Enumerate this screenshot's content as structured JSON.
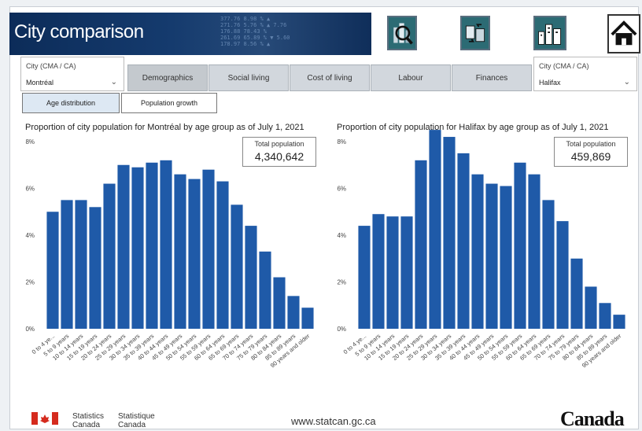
{
  "app": {
    "title": "City comparison",
    "banner_ticker": "377.76 8.98 % ▲\n271.76 5.76 % ▲ 7.76\n176.88 78.43 %\n261.69 65.89 % ▼ 5.60\n178.97 8.56 % ▲"
  },
  "nav_icons": [
    "city-search-icon",
    "city-compare-icon",
    "city-skyline-icon",
    "home-icon"
  ],
  "left_city": {
    "label": "City (CMA / CA)",
    "value": "Montréal"
  },
  "right_city": {
    "label": "City (CMA / CA)",
    "value": "Halifax"
  },
  "tabs": [
    "Demographics",
    "Social living",
    "Cost of living",
    "Labour",
    "Finances"
  ],
  "active_tab": "Demographics",
  "subtabs": [
    "Age distribution",
    "Population growth"
  ],
  "active_subtab": "Age distribution",
  "chart_data": [
    {
      "type": "bar",
      "title": "Proportion of city population for Montréal by age group as of July 1, 2021",
      "total_label": "Total population",
      "total_value": "4,340,642",
      "ylim": [
        0,
        8
      ],
      "yticks": [
        "0%",
        "2%",
        "4%",
        "6%",
        "8%"
      ],
      "grid": false,
      "color": "#1f5aa8",
      "categories": [
        "0 to 4 ye...",
        "5 to 9 years",
        "10 to 14 years",
        "15 to 19 years",
        "20 to 24 years",
        "25 to 29 years",
        "30 to 34 years",
        "35 to 39 years",
        "40 to 44 years",
        "45 to 49 years",
        "50 to 54 years",
        "55 to 59 years",
        "60 to 64 years",
        "65 to 69 years",
        "70 to 74 years",
        "75 to 79 years",
        "80 to 84 years",
        "85 to 89 years",
        "90 years and older"
      ],
      "values": [
        5.0,
        5.5,
        5.5,
        5.2,
        6.2,
        7.0,
        6.9,
        7.1,
        7.2,
        6.6,
        6.4,
        6.8,
        6.3,
        5.3,
        4.4,
        3.3,
        2.2,
        1.4,
        0.9
      ]
    },
    {
      "type": "bar",
      "title": "Proportion of city population for Halifax by age group as of July 1, 2021",
      "total_label": "Total population",
      "total_value": "459,869",
      "ylim": [
        0,
        8
      ],
      "yticks": [
        "0%",
        "2%",
        "4%",
        "6%",
        "8%"
      ],
      "grid": false,
      "color": "#1f5aa8",
      "categories": [
        "0 to 4 ye...",
        "5 to 9 years",
        "10 to 14 years",
        "15 to 19 years",
        "20 to 24 years",
        "25 to 29 years",
        "30 to 34 years",
        "35 to 39 years",
        "40 to 44 years",
        "45 to 49 years",
        "50 to 54 years",
        "55 to 59 years",
        "60 to 64 years",
        "65 to 69 years",
        "70 to 74 years",
        "75 to 79 years",
        "80 to 84 years",
        "85 to 89 years",
        "90 years and older"
      ],
      "values": [
        4.4,
        4.9,
        4.8,
        4.8,
        7.2,
        8.5,
        8.2,
        7.5,
        6.6,
        6.2,
        6.1,
        7.1,
        6.6,
        5.5,
        4.6,
        3.0,
        1.8,
        1.1,
        0.6
      ]
    }
  ],
  "footer": {
    "org_en": "Statistics\nCanada",
    "org_fr": "Statistique\nCanada",
    "url": "www.statcan.gc.ca",
    "wordmark": "Canada"
  }
}
